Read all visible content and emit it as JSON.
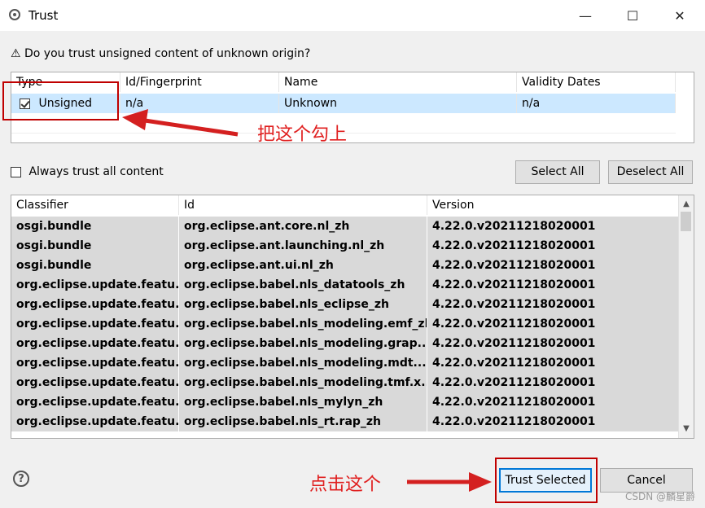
{
  "window": {
    "title": "Trust",
    "minimize": "—",
    "maximize": "☐",
    "close": "✕"
  },
  "question": "⚠ Do you trust unsigned content of unknown origin?",
  "certs_table": {
    "columns": [
      "Type",
      "Id/Fingerprint",
      "Name",
      "Validity Dates"
    ],
    "rows": [
      {
        "type": "Unsigned",
        "checked": true,
        "id": "n/a",
        "name": "Unknown",
        "validity": "n/a"
      }
    ]
  },
  "always_trust_label": "Always trust all content",
  "select_all_label": "Select All",
  "deselect_all_label": "Deselect All",
  "artifacts_table": {
    "columns": [
      "Classifier",
      "Id",
      "Version"
    ],
    "rows": [
      {
        "classifier": "osgi.bundle",
        "id": "org.eclipse.ant.core.nl_zh",
        "version": "4.22.0.v20211218020001"
      },
      {
        "classifier": "osgi.bundle",
        "id": "org.eclipse.ant.launching.nl_zh",
        "version": "4.22.0.v20211218020001"
      },
      {
        "classifier": "osgi.bundle",
        "id": "org.eclipse.ant.ui.nl_zh",
        "version": "4.22.0.v20211218020001"
      },
      {
        "classifier": "org.eclipse.update.featu...",
        "id": "org.eclipse.babel.nls_datatools_zh",
        "version": "4.22.0.v20211218020001"
      },
      {
        "classifier": "org.eclipse.update.featu...",
        "id": "org.eclipse.babel.nls_eclipse_zh",
        "version": "4.22.0.v20211218020001"
      },
      {
        "classifier": "org.eclipse.update.featu...",
        "id": "org.eclipse.babel.nls_modeling.emf_zh",
        "version": "4.22.0.v20211218020001"
      },
      {
        "classifier": "org.eclipse.update.featu...",
        "id": "org.eclipse.babel.nls_modeling.grap...",
        "version": "4.22.0.v20211218020001"
      },
      {
        "classifier": "org.eclipse.update.featu...",
        "id": "org.eclipse.babel.nls_modeling.mdt....",
        "version": "4.22.0.v20211218020001"
      },
      {
        "classifier": "org.eclipse.update.featu...",
        "id": "org.eclipse.babel.nls_modeling.tmf.x...",
        "version": "4.22.0.v20211218020001"
      },
      {
        "classifier": "org.eclipse.update.featu...",
        "id": "org.eclipse.babel.nls_mylyn_zh",
        "version": "4.22.0.v20211218020001"
      },
      {
        "classifier": "org.eclipse.update.featu...",
        "id": "org.eclipse.babel.nls_rt.rap_zh",
        "version": "4.22.0.v20211218020001"
      }
    ]
  },
  "help_icon": "?",
  "trust_selected_label": "Trust Selected",
  "cancel_label": "Cancel",
  "annotations": {
    "check_this": "把这个勾上",
    "click_this": "点击这个"
  },
  "watermark": "CSDN @麟星爵",
  "colors": {
    "selection": "#cce8ff",
    "artifact_row": "#d9d9d9",
    "annotation": "#e02020",
    "default_button_border": "#0078d7"
  }
}
